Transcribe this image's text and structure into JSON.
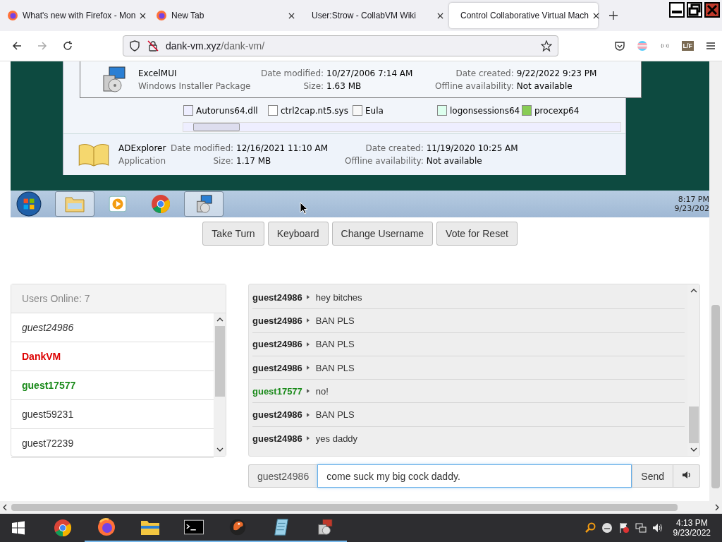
{
  "browser": {
    "tabs": [
      {
        "title": "What's new with Firefox - Mon",
        "selected": false
      },
      {
        "title": "New Tab",
        "selected": false
      },
      {
        "title": "User:Strow - CollabVM Wiki",
        "selected": false
      },
      {
        "title": "Control Collaborative Virtual Mach",
        "selected": true
      }
    ],
    "url": {
      "host": "dank-vm.xyz",
      "path": "/dank-vm/"
    },
    "extension_badge": "L/F"
  },
  "vm_screen": {
    "tooltip": {
      "name": "ExcelMUI",
      "type": "Windows Installer Package",
      "fields": [
        {
          "label": "Date modified:",
          "value": "10/27/2006 7:14 AM"
        },
        {
          "label": "Date created:",
          "value": "9/22/2022 9:23 PM"
        },
        {
          "label": "Size:",
          "value": "1.63 MB"
        },
        {
          "label": "Offline availability:",
          "value": "Not available"
        }
      ]
    },
    "files": [
      "Autoruns64.dll",
      "ctrl2cap.nt5.sys",
      "Eula",
      "logonsessions64",
      "procexp64"
    ],
    "details": {
      "name": "ADExplorer",
      "type": "Application",
      "fields": [
        {
          "label": "Date modified:",
          "value": "12/16/2021 11:10 AM"
        },
        {
          "label": "Date created:",
          "value": "11/19/2020 10:25 AM"
        },
        {
          "label": "Size:",
          "value": "1.17 MB"
        },
        {
          "label": "Offline availability:",
          "value": "Not available"
        }
      ]
    },
    "taskbar": {
      "items": [
        {
          "kind": "folder",
          "selected": true
        },
        {
          "kind": "media",
          "selected": false
        },
        {
          "kind": "chrome",
          "selected": false
        },
        {
          "kind": "installer",
          "selected": true
        }
      ],
      "time": "8:17 PM",
      "date": "9/23/202"
    }
  },
  "controls": [
    "Take Turn",
    "Keyboard",
    "Change Username",
    "Vote for Reset"
  ],
  "users": {
    "header": "Users Online: 7",
    "list": [
      {
        "name": "guest24986",
        "kind": "self"
      },
      {
        "name": "DankVM",
        "kind": "admin"
      },
      {
        "name": "guest17577",
        "kind": "registered"
      },
      {
        "name": "guest59231",
        "kind": "guest"
      },
      {
        "name": "guest72239",
        "kind": "guest"
      }
    ]
  },
  "chat": {
    "messages": [
      {
        "user": "guest24986",
        "kind": "guest",
        "text": "hey bitches"
      },
      {
        "user": "guest24986",
        "kind": "guest",
        "text": "BAN PLS"
      },
      {
        "user": "guest24986",
        "kind": "guest",
        "text": "BAN PLS"
      },
      {
        "user": "guest24986",
        "kind": "guest",
        "text": "BAN PLS"
      },
      {
        "user": "guest17577",
        "kind": "registered",
        "text": "no!"
      },
      {
        "user": "guest24986",
        "kind": "guest",
        "text": "BAN PLS"
      },
      {
        "user": "guest24986",
        "kind": "guest",
        "text": "yes daddy"
      }
    ],
    "username": "guest24986",
    "input": "come suck my big cock daddy.",
    "send": "Send"
  },
  "windows_taskbar": {
    "apps": [
      {
        "kind": "chrome",
        "running": false
      },
      {
        "kind": "firefox",
        "running": true
      },
      {
        "kind": "folder",
        "running": true
      },
      {
        "kind": "terminal",
        "running": true
      },
      {
        "kind": "bird",
        "running": true
      },
      {
        "kind": "notepad",
        "running": true
      },
      {
        "kind": "installer",
        "running": true
      }
    ],
    "time": "4:13 PM",
    "date": "9/23/2022"
  }
}
